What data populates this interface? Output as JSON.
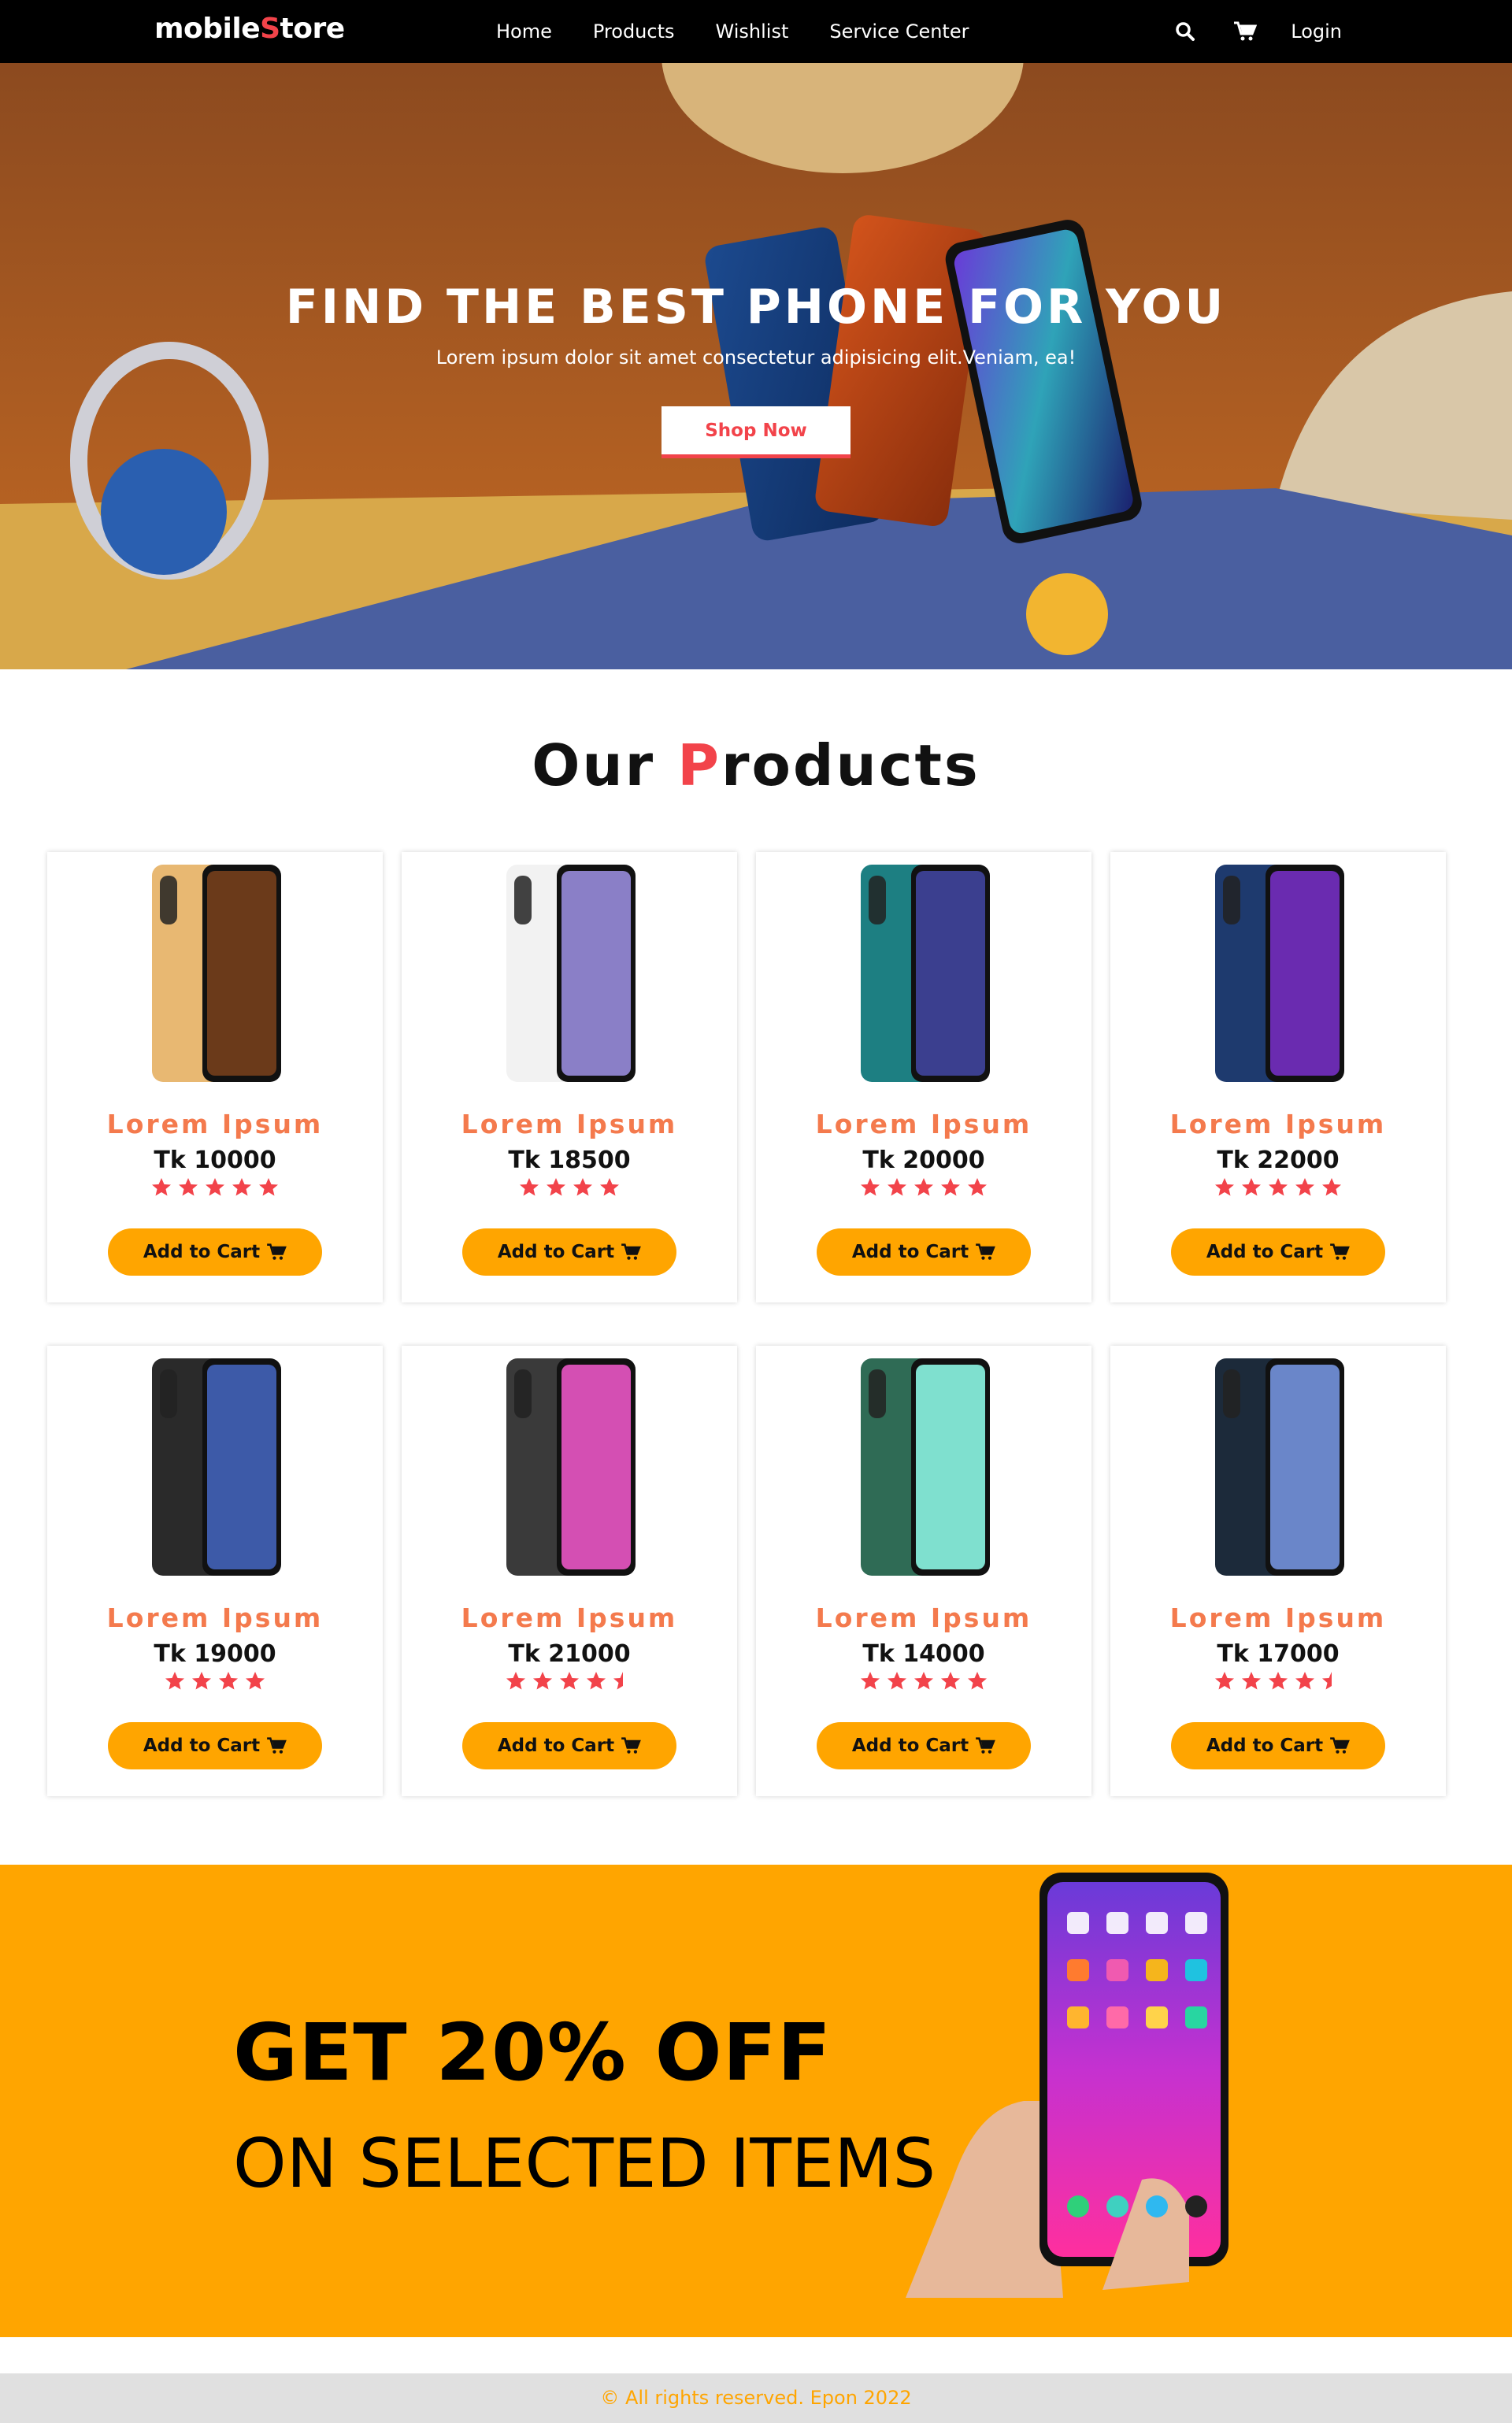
{
  "navbar": {
    "brand_prefix": "mobile",
    "brand_accent": "S",
    "brand_suffix": "tore",
    "links": [
      "Home",
      "Products",
      "Wishlist",
      "Service Center"
    ],
    "login": "Login",
    "icons": [
      "search-icon",
      "cart-icon"
    ]
  },
  "hero": {
    "title": "FIND THE BEST PHONE FOR YOU",
    "subtitle": "Lorem ipsum dolor sit amet consectetur adipisicing elit.Veniam, ea!",
    "button": "Shop Now"
  },
  "products_section": {
    "title_prefix": "Our ",
    "title_accent": "P",
    "title_suffix": "roducts"
  },
  "products": [
    {
      "name": "Lorem Ipsum",
      "price": "Tk 10000",
      "rating": 5,
      "button": "Add to Cart",
      "body": "#e8b872",
      "screen": "#6b3a1a"
    },
    {
      "name": "Lorem Ipsum",
      "price": "Tk 18500",
      "rating": 4,
      "button": "Add to Cart",
      "body": "#f2f2f2",
      "screen": "#8a7fc7"
    },
    {
      "name": "Lorem Ipsum",
      "price": "Tk 20000",
      "rating": 5,
      "button": "Add to Cart",
      "body": "#1d7f82",
      "screen": "#3b3f8f"
    },
    {
      "name": "Lorem Ipsum",
      "price": "Tk 22000",
      "rating": 5,
      "button": "Add to Cart",
      "body": "#1e3a6e",
      "screen": "#6a2bb0"
    },
    {
      "name": "Lorem Ipsum",
      "price": "Tk 19000",
      "rating": 4,
      "button": "Add to Cart",
      "body": "#2a2a2a",
      "screen": "#3d5aa8"
    },
    {
      "name": "Lorem Ipsum",
      "price": "Tk 21000",
      "rating": 4.5,
      "button": "Add to Cart",
      "body": "#3a3a3a",
      "screen": "#d44fb3"
    },
    {
      "name": "Lorem Ipsum",
      "price": "Tk 14000",
      "rating": 5,
      "button": "Add to Cart",
      "body": "#2f6b55",
      "screen": "#7fe0cf"
    },
    {
      "name": "Lorem Ipsum",
      "price": "Tk 17000",
      "rating": 4.5,
      "button": "Add to Cart",
      "body": "#1c2a3a",
      "screen": "#6a86c9"
    }
  ],
  "promo": {
    "headline": "GET 20% OFF",
    "subline": "ON SELECTED ITEMS"
  },
  "footer": {
    "text": "© All rights reserved. Epon 2022"
  },
  "colors": {
    "accent_red": "#f2434a",
    "accent_orange": "#ffa500",
    "product_name": "#f47a4d",
    "navbar_bg": "#000000"
  }
}
